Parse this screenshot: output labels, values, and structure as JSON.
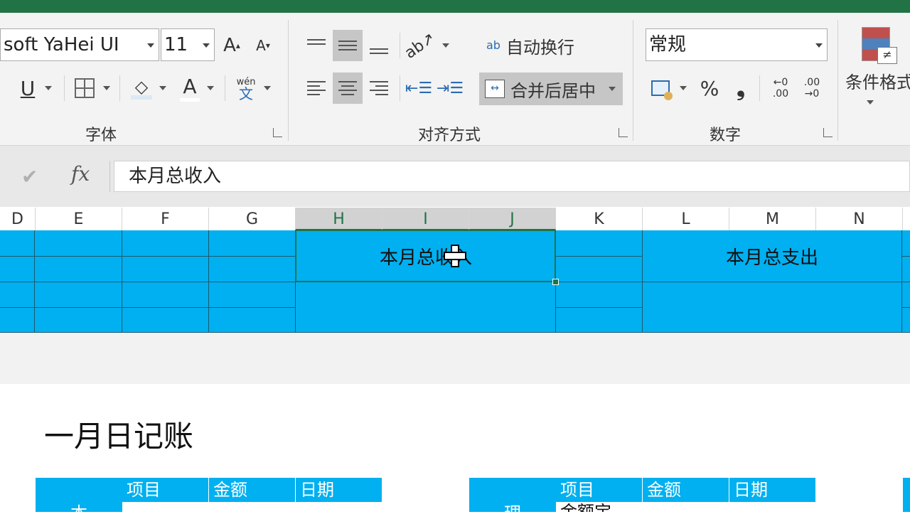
{
  "ribbon": {
    "font": {
      "group_label": "字体",
      "font_name": "soft YaHei UI",
      "font_size": "11",
      "grow_label": "A",
      "shrink_label": "A",
      "underline_label": "U",
      "font_color_label": "A",
      "phonetic_top": "wén",
      "phonetic_bottom": "文"
    },
    "alignment": {
      "group_label": "对齐方式",
      "wrap_text_label": "自动换行",
      "wrap_icon": "ab",
      "merge_center_label": "合并后居中"
    },
    "number": {
      "group_label": "数字",
      "format_value": "常规",
      "percent_label": "%",
      "comma_label": "❟",
      "inc_decimal_label": "←0 .00",
      "dec_decimal_label": ".00 →0"
    },
    "styles": {
      "conditional_format_label": "条件格式"
    }
  },
  "formula_bar": {
    "fx_label": "fx",
    "content": "本月总收入"
  },
  "columns": [
    "D",
    "E",
    "F",
    "G",
    "H",
    "I",
    "J",
    "K",
    "L",
    "M",
    "N"
  ],
  "selected_columns": [
    "H",
    "I",
    "J"
  ],
  "cells": {
    "total_income": "本月总收入",
    "total_expense": "本月总支出"
  },
  "sheet": {
    "section_title": "一月日记账",
    "table_left": {
      "side_label": "本",
      "headers": [
        "项目",
        "金额",
        "日期"
      ]
    },
    "table_right": {
      "side_label": "理",
      "headers": [
        "项目",
        "金额",
        "日期"
      ],
      "first_item": "金额宝"
    }
  },
  "colors": {
    "accent_green": "#217346",
    "cell_fill": "#00b0f0"
  }
}
